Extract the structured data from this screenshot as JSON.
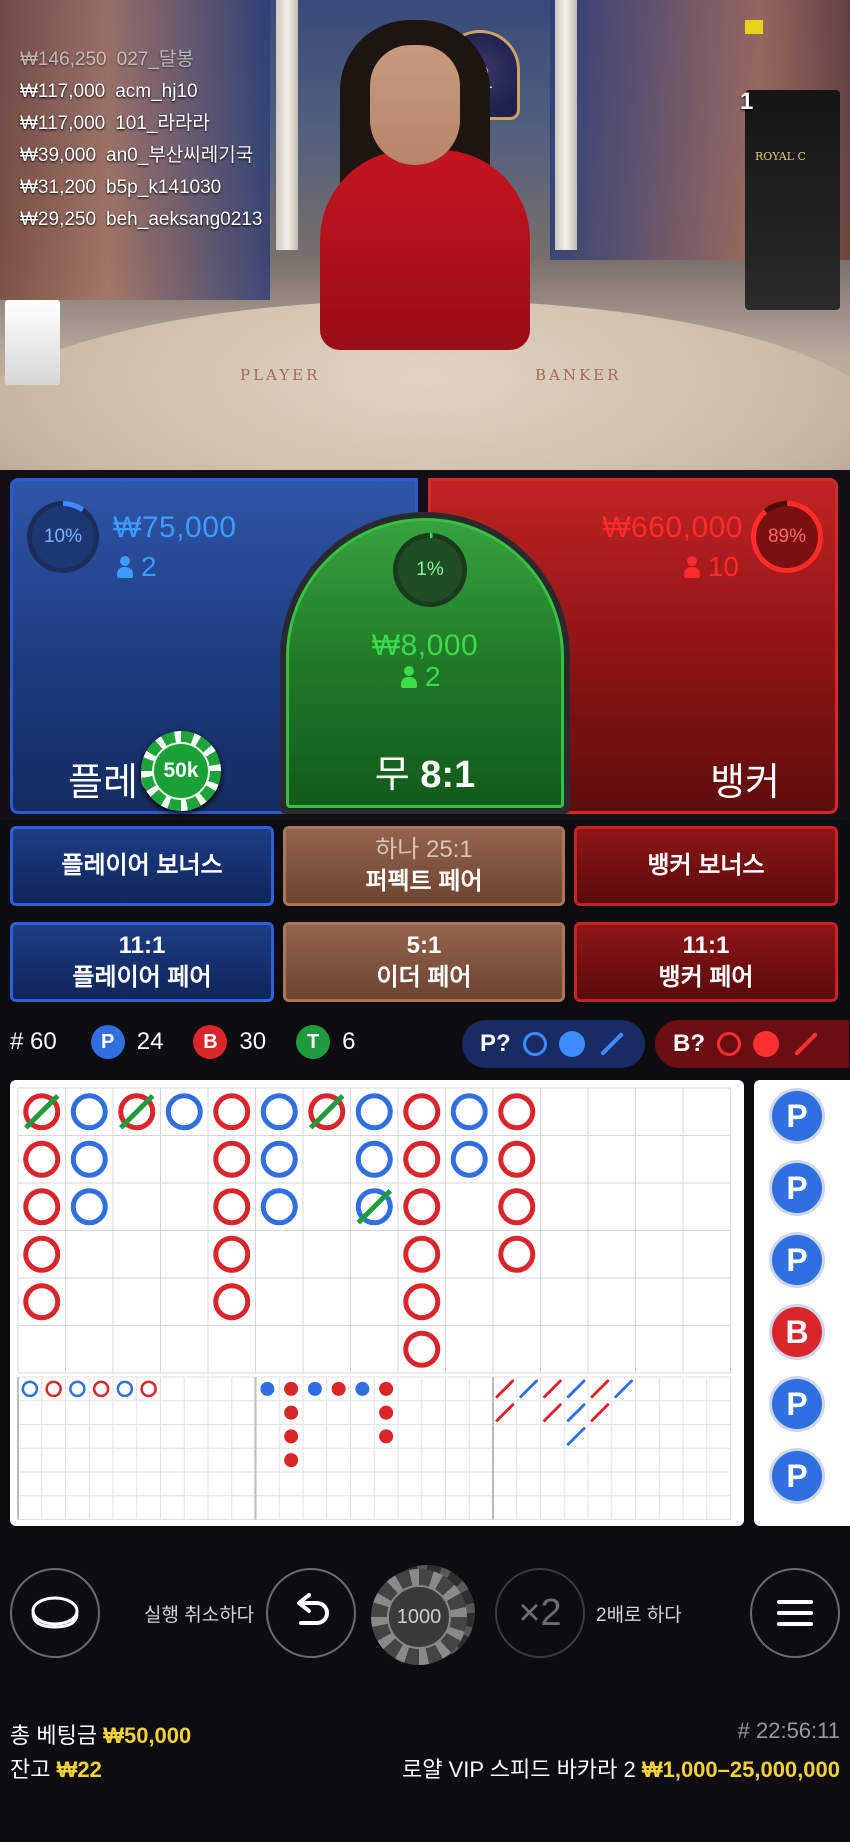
{
  "video": {
    "table_player_text": "PLAYER",
    "table_banker_text": "BANKER",
    "emblem_letter": "R",
    "shoe_logo": "ROYAL C",
    "viewer_count": "1",
    "winners": [
      {
        "amount": "₩146,250",
        "name": "027_달봉"
      },
      {
        "amount": "₩117,000",
        "name": "acm_hj10"
      },
      {
        "amount": "₩117,000",
        "name": "101_라라라"
      },
      {
        "amount": "₩39,000",
        "name": "an0_부산씨레기국"
      },
      {
        "amount": "₩31,200",
        "name": "b5p_k141030"
      },
      {
        "amount": "₩29,250",
        "name": "beh_aeksang0213"
      }
    ]
  },
  "bets": {
    "player": {
      "label": "플레이어",
      "percent": "10%",
      "percent_value": 10,
      "amount": "₩75,000",
      "count": "2",
      "color": "#3b8cff"
    },
    "tie": {
      "label_prefix": "무",
      "label_odds": "8:1",
      "percent": "1%",
      "percent_value": 1,
      "amount": "₩8,000",
      "count": "2",
      "color": "#3bdc4a"
    },
    "banker": {
      "label": "뱅커",
      "percent": "89%",
      "percent_value": 89,
      "amount": "₩660,000",
      "count": "10",
      "color": "#ff2a2a"
    },
    "placed_chip": "50k"
  },
  "side_bets": {
    "player_bonus": "플레이어 보너스",
    "perfect_pair_odds": "하나 25:1",
    "perfect_pair": "퍼펙트 페어",
    "banker_bonus": "뱅커 보너스",
    "player_pair_odds": "11:1",
    "player_pair": "플레이어 페어",
    "either_pair_odds": "5:1",
    "either_pair": "이더 페어",
    "banker_pair_odds": "11:1",
    "banker_pair": "뱅커 페어"
  },
  "stats": {
    "rounds": "# 60",
    "player_letter": "P",
    "player_count": "24",
    "banker_letter": "B",
    "banker_count": "30",
    "tie_letter": "T",
    "tie_count": "6",
    "player_predict": "P?",
    "banker_predict": "B?"
  },
  "roadmap": {
    "big_road": [
      [
        "B",
        "P",
        "B",
        "P",
        "B",
        "P",
        "B",
        "P",
        "B",
        "P",
        "B"
      ],
      [
        "B",
        "P",
        "",
        "",
        "B",
        "P",
        "",
        "P",
        "B",
        "P",
        "B"
      ],
      [
        "B",
        "P",
        "",
        "",
        "B",
        "P",
        "",
        "P",
        "B",
        "",
        "B"
      ],
      [
        "B",
        "",
        "",
        "",
        "B",
        "",
        "",
        "",
        "B",
        "",
        "B"
      ],
      [
        "B",
        "",
        "",
        "",
        "B",
        "",
        "",
        "",
        "B",
        "",
        ""
      ],
      [
        "",
        "",
        "",
        "",
        "",
        "",
        "",
        "",
        "B",
        "",
        ""
      ]
    ],
    "side_column": [
      "P",
      "P",
      "P",
      "B",
      "P",
      "P"
    ]
  },
  "controls": {
    "undo_label": "실행 취소하다",
    "chip_value": "1000",
    "double_symbol": "×2",
    "double_label": "2배로 하다"
  },
  "footer": {
    "total_bet_label": "총 베팅금",
    "total_bet": "₩50,000",
    "balance_label": "잔고",
    "balance": "₩22",
    "round_time": "# 22:56:11",
    "table_name": "로얄 VIP 스피드 바카라 2",
    "limits": "₩1,000–25,000,000"
  },
  "colors": {
    "player": "#2f6fe0",
    "banker": "#d8262b",
    "tie": "#1f9a3c",
    "gold": "#f3d13a"
  }
}
